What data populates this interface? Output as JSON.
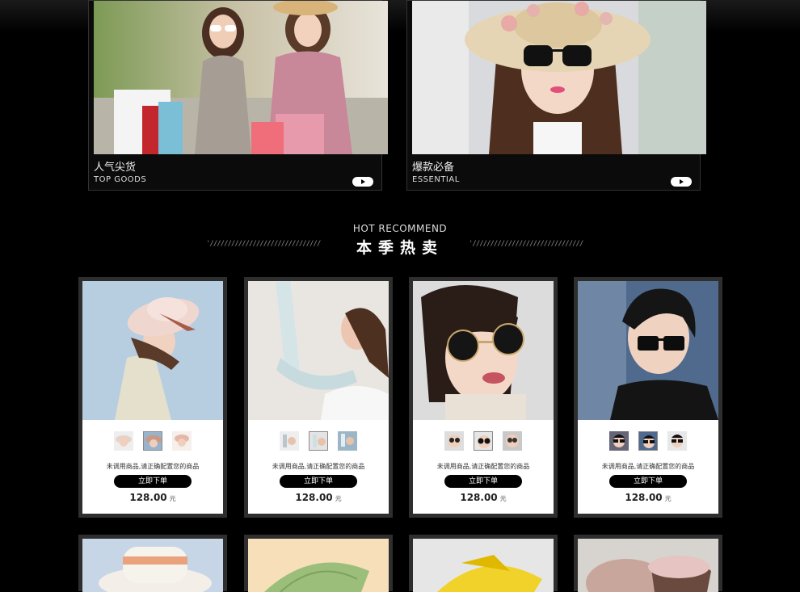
{
  "banners": [
    {
      "title_cn": "人气尖货",
      "title_en": "TOP GOODS"
    },
    {
      "title_cn": "爆款必备",
      "title_en": "ESSENTIAL"
    }
  ],
  "section": {
    "title_en": "HOT RECOMMEND",
    "title_cn": "本季热卖",
    "deco": "'///////////////////////////////"
  },
  "products": [
    {
      "desc": "未调用商品,请正确配置您的商品",
      "buy_label": "立即下单",
      "price": "128.00",
      "unit": "元"
    },
    {
      "desc": "未调用商品,请正确配置您的商品",
      "buy_label": "立即下单",
      "price": "128.00",
      "unit": "元"
    },
    {
      "desc": "未调用商品,请正确配置您的商品",
      "buy_label": "立即下单",
      "price": "128.00",
      "unit": "元"
    },
    {
      "desc": "未调用商品,请正确配置您的商品",
      "buy_label": "立即下单",
      "price": "128.00",
      "unit": "元"
    }
  ],
  "colors": {
    "background": "#000000",
    "card_frame": "#2e2e2e",
    "button": "#000000"
  }
}
